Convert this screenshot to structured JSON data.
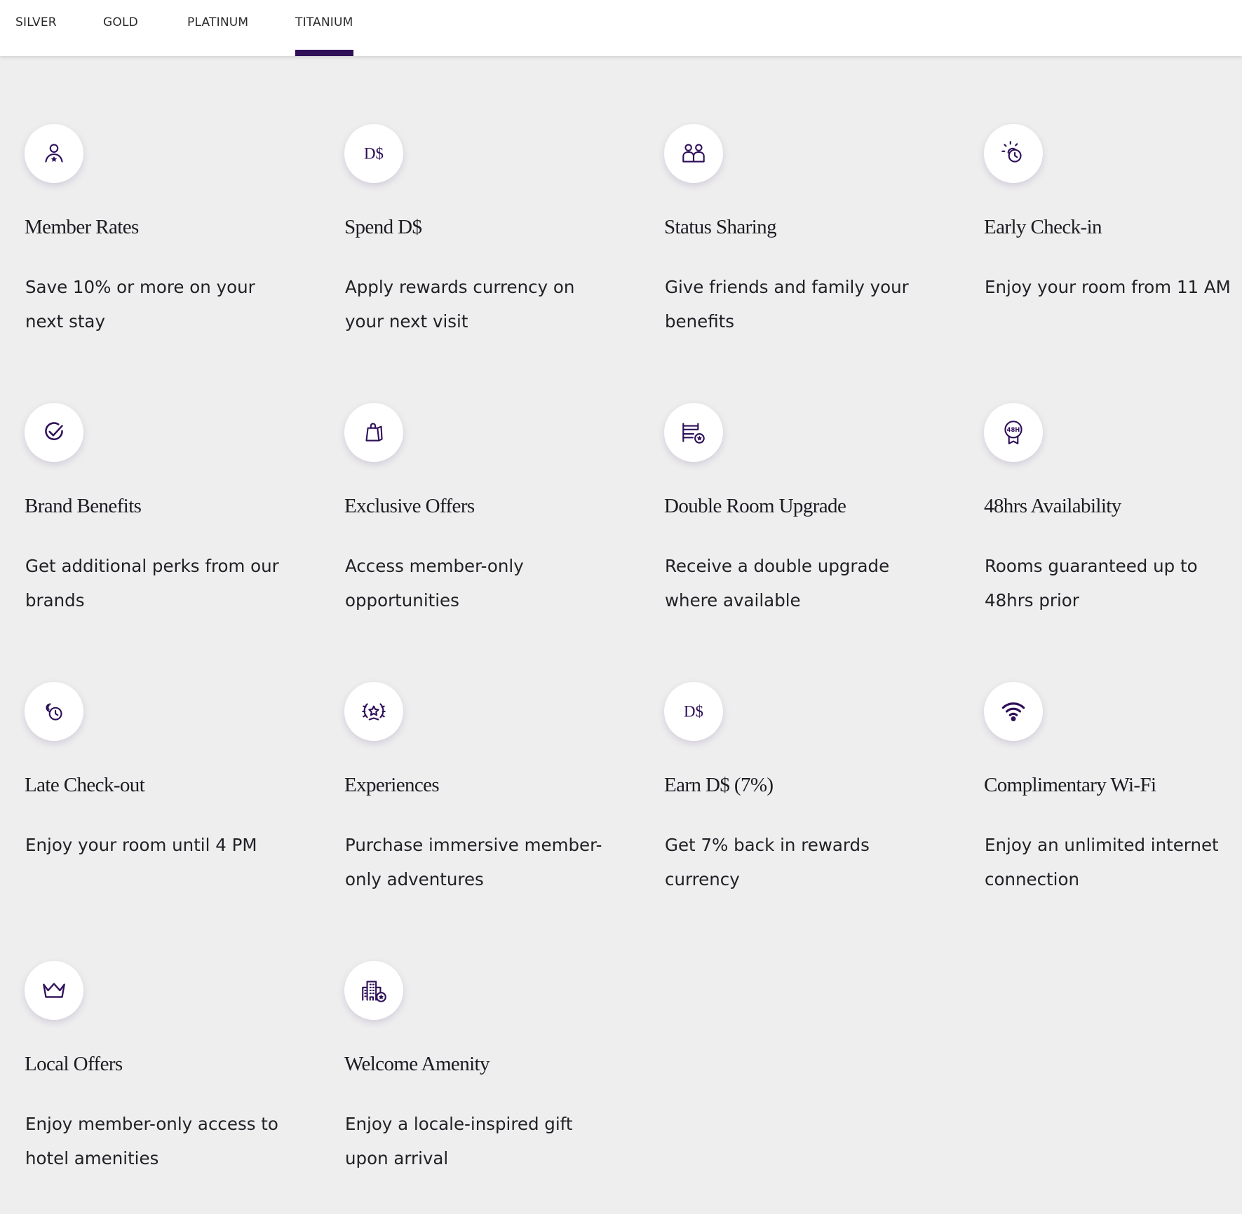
{
  "tabs": [
    {
      "label": "SILVER",
      "active": false
    },
    {
      "label": "GOLD",
      "active": false
    },
    {
      "label": "PLATINUM",
      "active": false
    },
    {
      "label": "TITANIUM",
      "active": true
    }
  ],
  "accent_color": "#2e0f58",
  "benefits": [
    {
      "icon": "member-rates-icon",
      "title": "Member Rates",
      "description": "Save 10% or more on your next stay"
    },
    {
      "icon": "ds-currency-icon",
      "icon_text": "D$",
      "title": "Spend D$",
      "description": "Apply rewards currency on your next visit"
    },
    {
      "icon": "status-sharing-icon",
      "title": "Status Sharing",
      "description": "Give friends and family your benefits"
    },
    {
      "icon": "early-check-in-icon",
      "title": "Early Check-in",
      "description": "Enjoy your room from 11 AM"
    },
    {
      "icon": "check-circle-icon",
      "title": "Brand Benefits",
      "description": "Get additional perks from our brands"
    },
    {
      "icon": "shopping-bag-icon",
      "title": "Exclusive Offers",
      "description": "Access member-only opportunities"
    },
    {
      "icon": "bed-star-icon",
      "title": "Double Room Upgrade",
      "description": "Receive a double upgrade where available"
    },
    {
      "icon": "48h-badge-icon",
      "icon_text": "48H",
      "title": "48hrs Availability",
      "description": "Rooms guaranteed up to 48hrs prior"
    },
    {
      "icon": "late-check-out-icon",
      "title": "Late Check-out",
      "description": "Enjoy your room until 4 PM"
    },
    {
      "icon": "laurel-star-icon",
      "title": "Experiences",
      "description": "Purchase immersive member-only adventures"
    },
    {
      "icon": "ds-currency-icon",
      "icon_text": "D$",
      "title": "Earn D$ (7%)",
      "description": "Get 7% back in rewards currency"
    },
    {
      "icon": "wifi-icon",
      "title": "Complimentary Wi-Fi",
      "description": "Enjoy an unlimited internet connection"
    },
    {
      "icon": "crown-icon",
      "title": "Local Offers",
      "description": "Enjoy member-only access to hotel amenities"
    },
    {
      "icon": "hotel-building-icon",
      "title": "Welcome Amenity",
      "description": "Enjoy a locale-inspired gift upon arrival"
    }
  ]
}
